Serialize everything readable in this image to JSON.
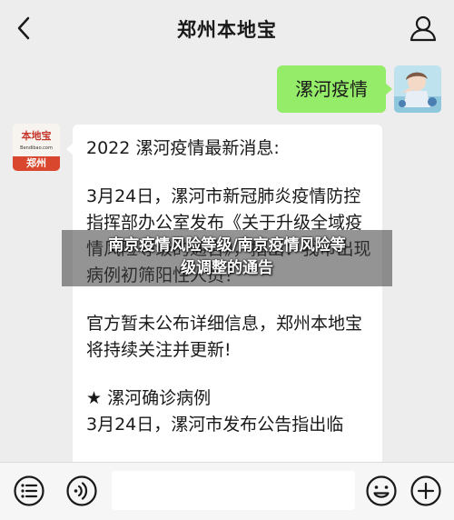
{
  "header": {
    "title": "郑州本地宝"
  },
  "messages": {
    "outgoing": {
      "text": "漯河疫情"
    },
    "incoming": {
      "avatar_logo_cn": "本地宝",
      "avatar_logo_en": "Bendibao.com",
      "avatar_logo_city": "郑州",
      "paragraphs": [
        "2022 漯河疫情最新消息:",
        "3月24日，漯河市新冠肺炎疫情防控指挥部办公室发布《关于升级全域疫情风险等级的通告》，指出：我市出现病例初筛阳性人员！",
        "官方暂未公布详细信息，郑州本地宝将持续关注并更新!",
        "★ 漯河确诊病例",
        "3月24日，漯河市发布公告指出临"
      ]
    }
  },
  "overlay": {
    "line1": "南京疫情风险等级/南京疫情风险等",
    "line2": "级调整的通告"
  },
  "colors": {
    "outgoing_bubble": "#95ec69",
    "incoming_bubble": "#ffffff",
    "background": "#ededed"
  },
  "icons": {
    "back": "chevron-left-icon",
    "profile": "person-icon",
    "voice": "voice-icon",
    "emoji": "emoji-icon",
    "plus": "plus-icon",
    "menu": "menu-list-icon"
  }
}
